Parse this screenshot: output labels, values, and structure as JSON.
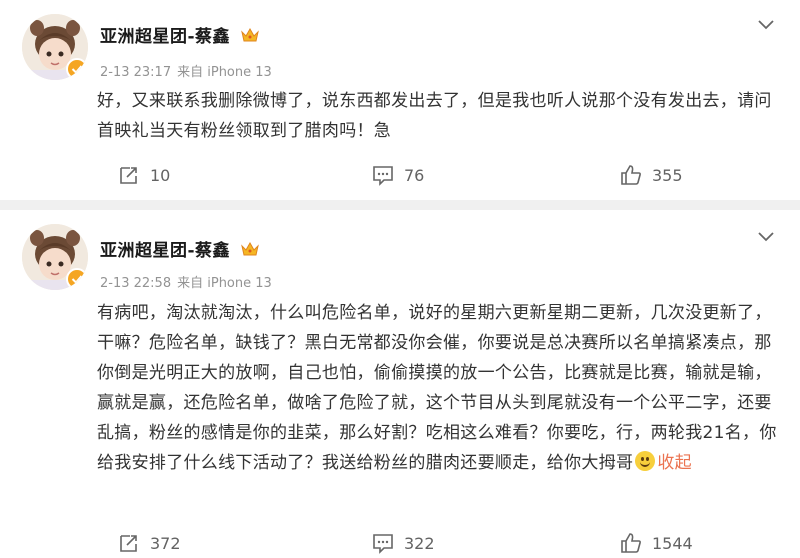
{
  "posts": [
    {
      "username": "亚洲超星团-蔡鑫",
      "date": "2-13 23:17",
      "source": "来自 iPhone 13",
      "text": "好，又来联系我删除微博了，说东西都发出去了，但是我也听人说那个没有发出去，请问首映礼当天有粉丝领取到了腊肉吗！急",
      "reposts": "10",
      "comments": "76",
      "likes": "355"
    },
    {
      "username": "亚洲超星团-蔡鑫",
      "date": "2-13 22:58",
      "source": "来自 iPhone 13",
      "text": "有病吧，淘汰就淘汰，什么叫危险名单，说好的星期六更新星期二更新，几次没更新了，干嘛？危险名单，缺钱了？黑白无常都没你会催，你要说是总决赛所以名单搞紧凑点，那你倒是光明正大的放啊，自己也怕，偷偷摸摸的放一个公告，比赛就是比赛，输就是输，赢就是赢，还危险名单，做啥了危险了就，这个节目从头到尾就没有一个公平二字，还要乱搞，粉丝的感情是你的韭菜，那么好割？吃相这么难看？你要吃，行，两轮我21名，你给我安排了什么线下活动了？我送给粉丝的腊肉还要顺走，给你大拇哥",
      "collapse": "收起",
      "reposts": "372",
      "comments": "322",
      "likes": "1544"
    }
  ],
  "icons": {
    "repost": "repost-icon",
    "comment": "comment-icon",
    "like": "like-icon",
    "more": "chevron-down-icon",
    "verified": "verified-badge-icon",
    "crown": "crown-icon",
    "emoji": "smile-emoji-icon"
  },
  "colors": {
    "link": "#eb7350",
    "meta": "#939393",
    "verified": "#f5a623"
  }
}
